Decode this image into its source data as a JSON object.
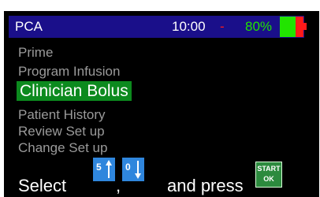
{
  "status": {
    "app_title": "PCA",
    "time": "10:00",
    "separator": "-",
    "battery_percent": "80%",
    "battery_level": 0.8,
    "colors": {
      "bar": "#1a0f8a",
      "battery_ok": "#22e400",
      "alert": "#ff1a1a"
    }
  },
  "menu": {
    "items": [
      {
        "label": "Prime"
      },
      {
        "label": "Program Infusion"
      },
      {
        "label": "Clinician Bolus"
      },
      {
        "label": "Patient History"
      },
      {
        "label": "Review Set up"
      },
      {
        "label": "Change Set up"
      }
    ],
    "selected_index": 2,
    "colors": {
      "item": "#9a9a9a",
      "selected_bg": "#0c8a1e"
    }
  },
  "instruction": {
    "select": "Select",
    "comma": ",",
    "and_press": "and press"
  },
  "keys": {
    "up": {
      "digit": "5",
      "icon": "arrow-up-icon"
    },
    "down": {
      "digit": "0",
      "icon": "arrow-down-icon"
    },
    "start_ok": {
      "top": "START",
      "bottom": "OK"
    }
  }
}
